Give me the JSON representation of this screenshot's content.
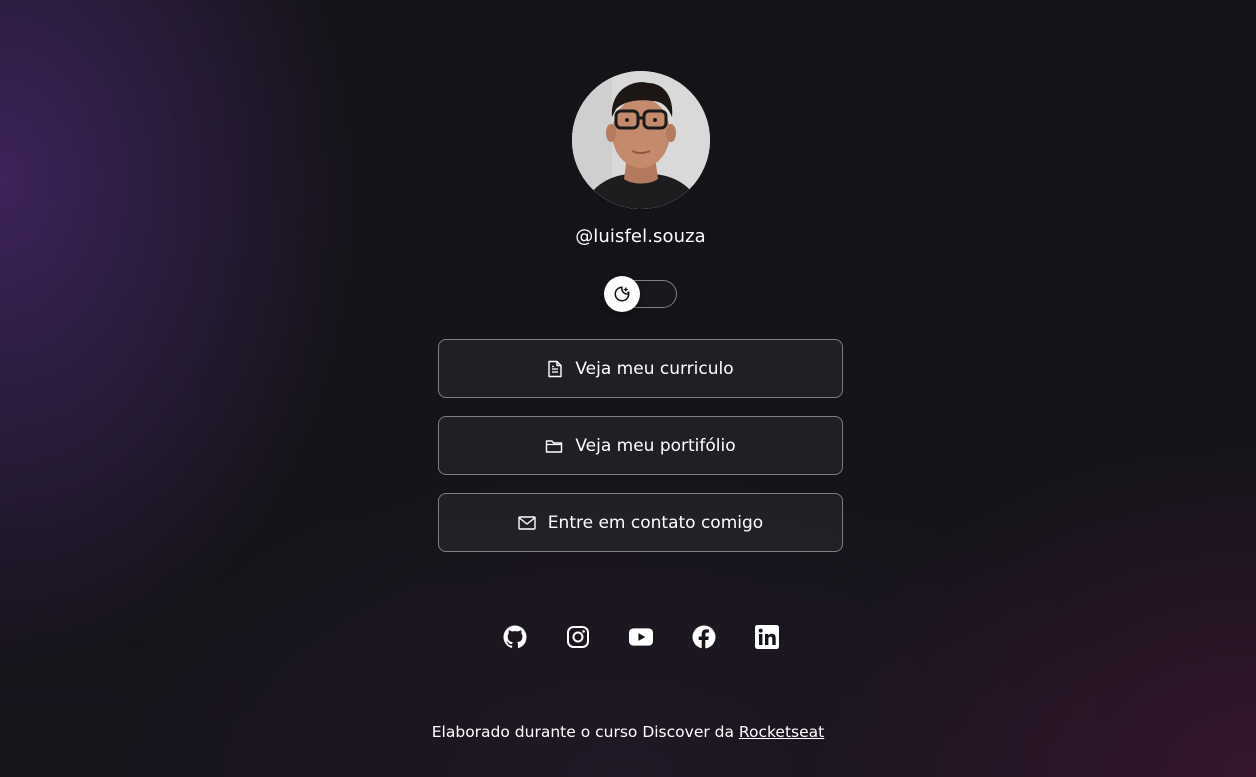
{
  "profile": {
    "username": "@luisfel.souza"
  },
  "theme_switch": {
    "icon": "moon-stars-icon"
  },
  "links": [
    {
      "label": "Veja meu curriculo",
      "icon": "file-text-icon"
    },
    {
      "label": "Veja meu portifólio",
      "icon": "folder-icon"
    },
    {
      "label": "Entre em contato comigo",
      "icon": "mail-icon"
    }
  ],
  "socials": [
    {
      "name": "github-icon"
    },
    {
      "name": "instagram-icon"
    },
    {
      "name": "youtube-icon"
    },
    {
      "name": "facebook-icon"
    },
    {
      "name": "linkedin-icon"
    }
  ],
  "footer": {
    "text": "Elaborado durante o curso Discover da ",
    "link_label": "Rocketseat"
  },
  "colors": {
    "text": "#ffffff",
    "background": "#121214",
    "accent_purple": "#48286e",
    "accent_magenta": "#3e1634"
  }
}
